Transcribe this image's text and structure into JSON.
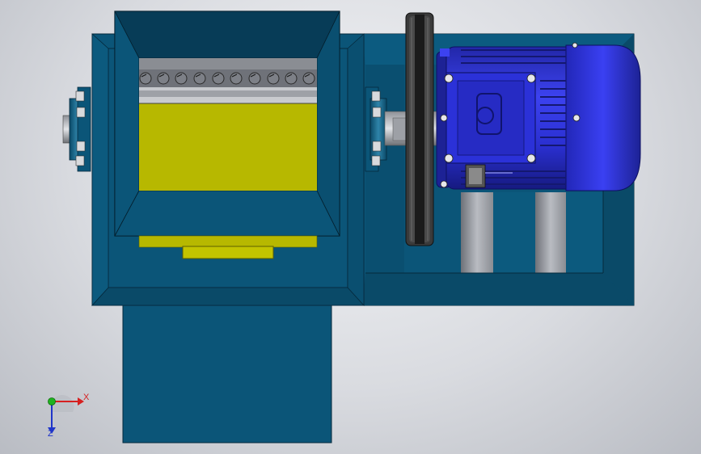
{
  "scene": {
    "view": "top",
    "components": [
      "crusher-hopper",
      "cutter-shaft",
      "bearing-housing",
      "drive-pulley",
      "v-belt",
      "electric-motor",
      "motor-base-frame",
      "discharge-chute"
    ]
  },
  "triad": {
    "x_label": "X",
    "z_label": "Z",
    "colors": {
      "x": "#d62020",
      "y": "#1fb31f",
      "z": "#1f35c9"
    }
  },
  "colors": {
    "frame": "#0b5578",
    "frame_dark": "#073c57",
    "frame_light": "#1a6b91",
    "hopper_inner": "#0a4866",
    "cutter_plate": "#b7b800",
    "motor": "#2a2fd0",
    "motor_dark": "#1a1f9a",
    "pulley": "#2b2b2b"
  }
}
